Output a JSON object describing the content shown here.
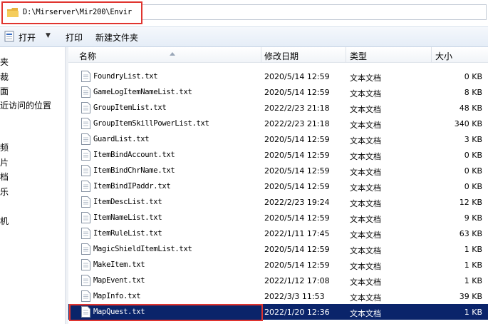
{
  "address": {
    "path": "D:\\Mirserver\\Mir200\\Envir"
  },
  "toolbar": {
    "open_label": "打开",
    "print_label": "打印",
    "new_folder_label": "新建文件夹"
  },
  "nav": {
    "items": [
      "夹",
      "裁",
      "面",
      "近访问的位置",
      "频",
      "片",
      "档",
      "乐",
      "机"
    ]
  },
  "columns": {
    "name": "名称",
    "date": "修改日期",
    "type": "类型",
    "size": "大小"
  },
  "files": [
    {
      "name": "FoundryList.txt",
      "date": "2020/5/14 12:59",
      "type": "文本文档",
      "size": "0 KB"
    },
    {
      "name": "GameLogItemNameList.txt",
      "date": "2020/5/14 12:59",
      "type": "文本文档",
      "size": "8 KB"
    },
    {
      "name": "GroupItemList.txt",
      "date": "2022/2/23 21:18",
      "type": "文本文档",
      "size": "48 KB"
    },
    {
      "name": "GroupItemSkillPowerList.txt",
      "date": "2022/2/23 21:18",
      "type": "文本文档",
      "size": "340 KB"
    },
    {
      "name": "GuardList.txt",
      "date": "2020/5/14 12:59",
      "type": "文本文档",
      "size": "3 KB"
    },
    {
      "name": "ItemBindAccount.txt",
      "date": "2020/5/14 12:59",
      "type": "文本文档",
      "size": "0 KB"
    },
    {
      "name": "ItemBindChrName.txt",
      "date": "2020/5/14 12:59",
      "type": "文本文档",
      "size": "0 KB"
    },
    {
      "name": "ItemBindIPaddr.txt",
      "date": "2020/5/14 12:59",
      "type": "文本文档",
      "size": "0 KB"
    },
    {
      "name": "ItemDescList.txt",
      "date": "2022/2/23 19:24",
      "type": "文本文档",
      "size": "12 KB"
    },
    {
      "name": "ItemNameList.txt",
      "date": "2020/5/14 12:59",
      "type": "文本文档",
      "size": "9 KB"
    },
    {
      "name": "ItemRuleList.txt",
      "date": "2022/1/11 17:45",
      "type": "文本文档",
      "size": "63 KB"
    },
    {
      "name": "MagicShieldItemList.txt",
      "date": "2020/5/14 12:59",
      "type": "文本文档",
      "size": "1 KB"
    },
    {
      "name": "MakeItem.txt",
      "date": "2020/5/14 12:59",
      "type": "文本文档",
      "size": "1 KB"
    },
    {
      "name": "MapEvent.txt",
      "date": "2022/1/12 17:08",
      "type": "文本文档",
      "size": "1 KB"
    },
    {
      "name": "MapInfo.txt",
      "date": "2022/3/3 11:53",
      "type": "文本文档",
      "size": "39 KB"
    },
    {
      "name": "MapQuest.txt",
      "date": "2022/1/20 12:36",
      "type": "文本文档",
      "size": "1 KB",
      "selected": true
    }
  ],
  "colors": {
    "selection": "#0a246a",
    "highlight_box": "#e0342f",
    "folder": "#e8b33c"
  },
  "icons": {
    "address": "folder-icon",
    "open": "open-icon",
    "file": "text-file-icon"
  }
}
